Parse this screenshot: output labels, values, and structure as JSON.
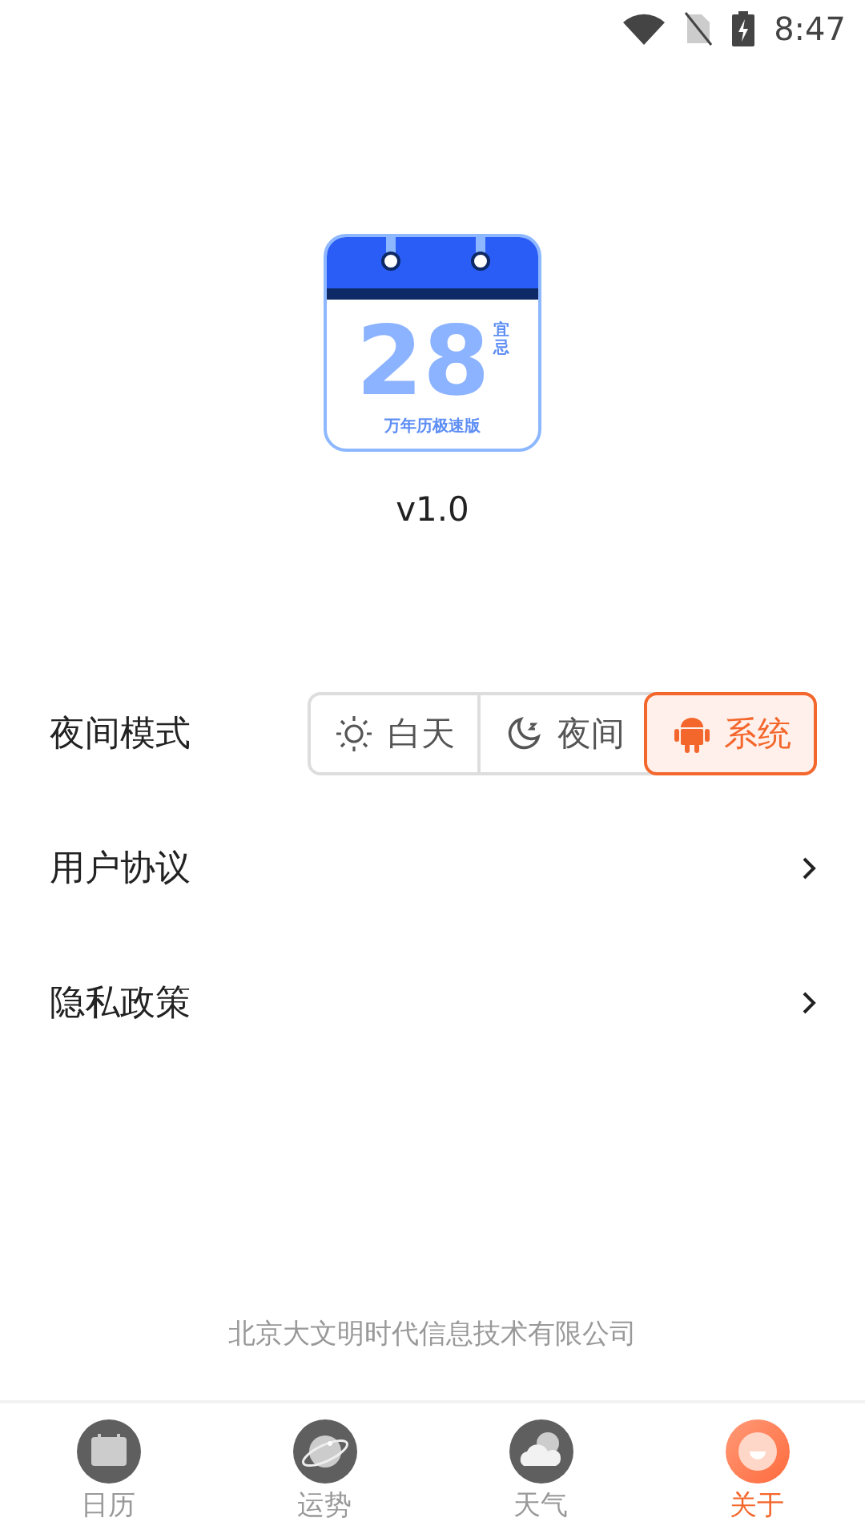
{
  "status_bar": {
    "time": "8:47"
  },
  "app_logo": {
    "day": "28",
    "badge_top": "宜",
    "badge_bottom": "忌",
    "caption": "万年历极速版"
  },
  "version": "v1.0",
  "night_mode": {
    "label": "夜间模式",
    "options": [
      {
        "kind": "day",
        "label": "白天",
        "selected": false
      },
      {
        "kind": "night",
        "label": "夜间",
        "selected": false
      },
      {
        "kind": "system",
        "label": "系统",
        "selected": true
      }
    ]
  },
  "links": [
    {
      "label": "用户协议"
    },
    {
      "label": "隐私政策"
    }
  ],
  "company": "北京大文明时代信息技术有限公司",
  "tabs": [
    {
      "kind": "calendar",
      "label": "日历",
      "selected": false
    },
    {
      "kind": "fortune",
      "label": "运势",
      "selected": false
    },
    {
      "kind": "weather",
      "label": "天气",
      "selected": false
    },
    {
      "kind": "about",
      "label": "关于",
      "selected": true
    }
  ]
}
